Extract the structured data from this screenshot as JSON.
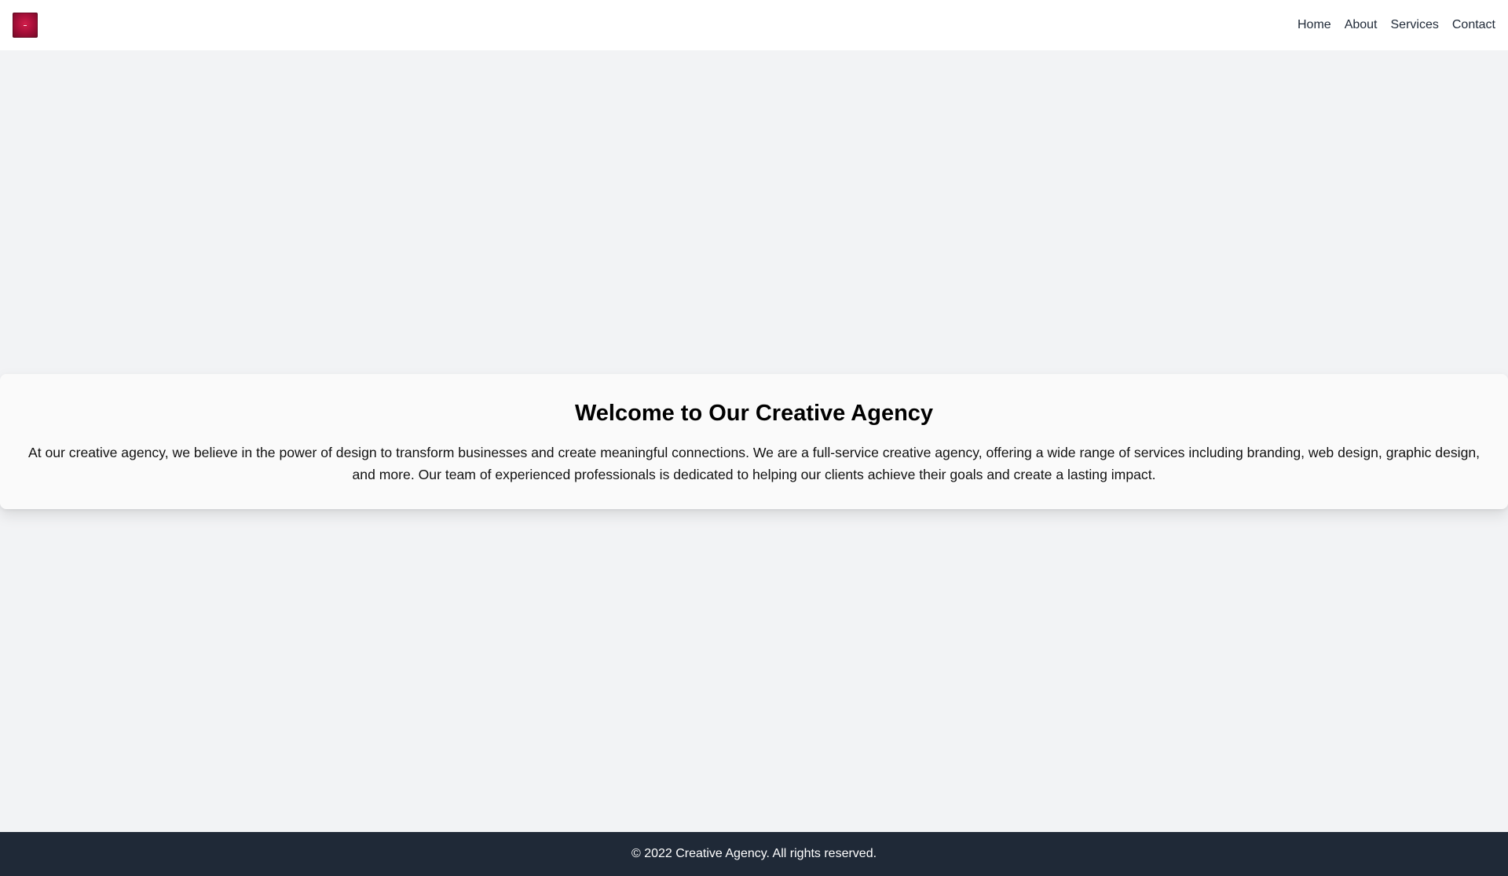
{
  "header": {
    "logo_icon": "agency-logo-icon",
    "nav": [
      {
        "label": "Home"
      },
      {
        "label": "About"
      },
      {
        "label": "Services"
      },
      {
        "label": "Contact"
      }
    ]
  },
  "hero": {
    "title": "Welcome to Our Creative Agency",
    "paragraph": "At our creative agency, we believe in the power of design to transform businesses and create meaningful connections. We are a full-service creative agency, offering a wide range of services including branding, web design, graphic design, and more. Our team of experienced professionals is dedicated to helping our clients achieve their goals and create a lasting impact."
  },
  "footer": {
    "text": "© 2022 Creative Agency. All rights reserved."
  },
  "colors": {
    "page_background": "#f2f3f5",
    "header_background": "#ffffff",
    "card_background": "#fafafa",
    "footer_background": "#1f2937",
    "nav_text": "#1f2937",
    "logo": "#a9103a"
  }
}
